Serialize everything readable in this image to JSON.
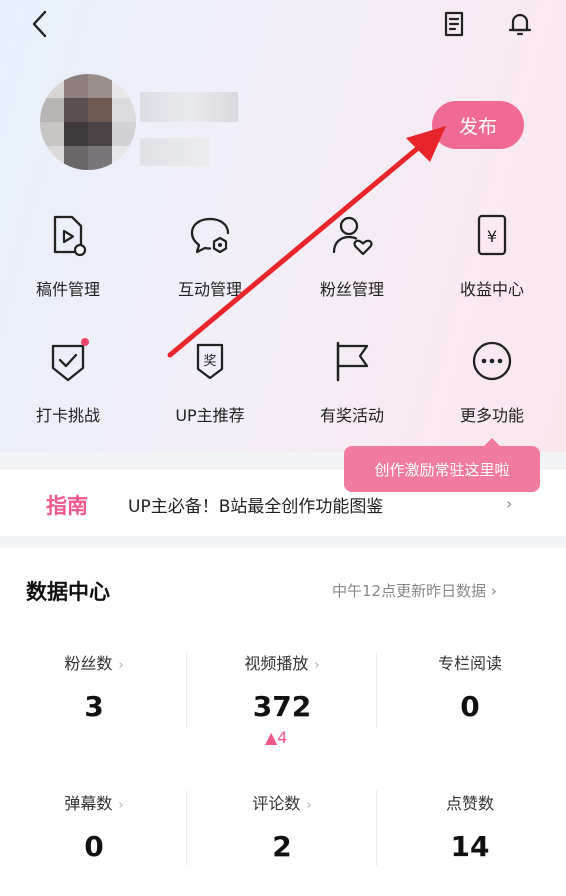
{
  "header": {
    "back_icon": "chevron-left-icon",
    "doc_icon": "document-icon",
    "bell_icon": "bell-icon"
  },
  "profile": {
    "publish_label": "发布"
  },
  "grid": [
    {
      "label": "稿件管理",
      "icon": "manuscript-icon"
    },
    {
      "label": "互动管理",
      "icon": "interaction-icon"
    },
    {
      "label": "粉丝管理",
      "icon": "fans-icon"
    },
    {
      "label": "收益中心",
      "icon": "income-icon"
    },
    {
      "label": "打卡挑战",
      "icon": "checkin-icon"
    },
    {
      "label": "UP主推荐",
      "icon": "recommend-icon"
    },
    {
      "label": "有奖活动",
      "icon": "flag-icon"
    },
    {
      "label": "更多功能",
      "icon": "more-icon"
    }
  ],
  "tooltip": {
    "text": "创作激励常驻这里啦"
  },
  "guide": {
    "tag": "指南",
    "text": "UP主必备！B站最全创作功能图鉴",
    "chevron": "›"
  },
  "data_center": {
    "title": "数据中心",
    "update_text": "中午12点更新昨日数据 ›",
    "stats": [
      {
        "label": "粉丝数",
        "has_chevron": true,
        "value": "3"
      },
      {
        "label": "视频播放",
        "has_chevron": true,
        "value": "372"
      },
      {
        "label": "专栏阅读",
        "has_chevron": false,
        "value": "0"
      },
      {
        "label": "弹幕数",
        "has_chevron": true,
        "value": "0"
      },
      {
        "label": "评论数",
        "has_chevron": true,
        "value": "2"
      },
      {
        "label": "点赞数",
        "has_chevron": false,
        "value": "14"
      }
    ],
    "play_delta": "▲4",
    "chevron": "›"
  },
  "colors": {
    "accent": "#f06b94",
    "arrow": "#e8252a"
  }
}
